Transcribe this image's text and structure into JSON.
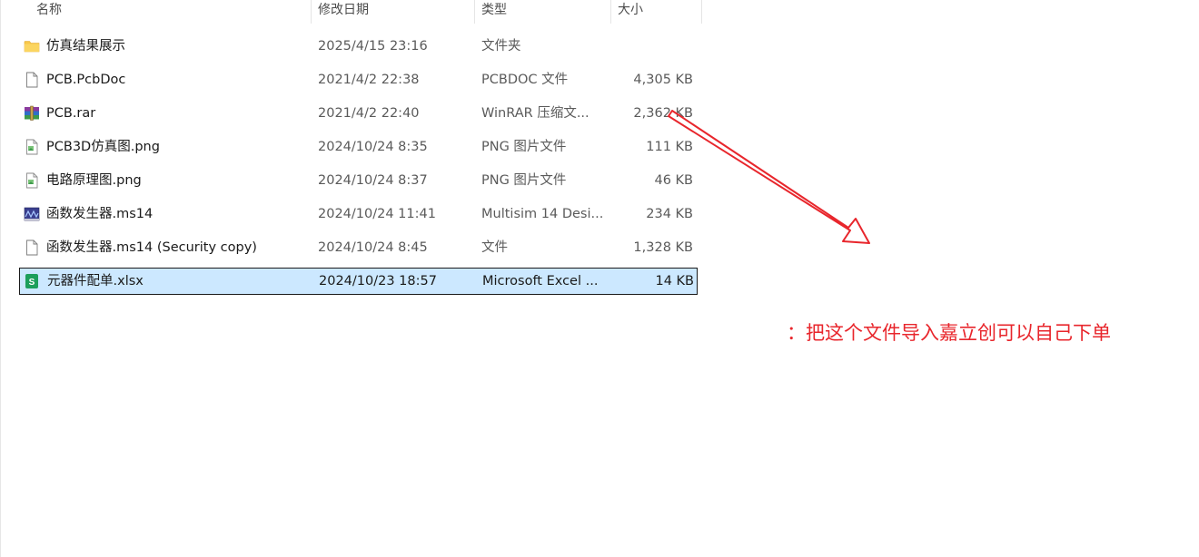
{
  "columns": {
    "name": "名称",
    "date": "修改日期",
    "type": "类型",
    "size": "大小"
  },
  "files": [
    {
      "name": "仿真结果展示",
      "date": "2025/4/15 23:16",
      "type": "文件夹",
      "size": "",
      "icon": "folder-icon"
    },
    {
      "name": "PCB.PcbDoc",
      "date": "2021/4/2 22:38",
      "type": "PCBDOC 文件",
      "size": "4,305 KB",
      "icon": "document-icon"
    },
    {
      "name": "PCB.rar",
      "date": "2021/4/2 22:40",
      "type": "WinRAR 压缩文...",
      "size": "2,362 KB",
      "icon": "winrar-icon"
    },
    {
      "name": "PCB3D仿真图.png",
      "date": "2024/10/24 8:35",
      "type": "PNG 图片文件",
      "size": "111 KB",
      "icon": "image-icon"
    },
    {
      "name": "电路原理图.png",
      "date": "2024/10/24 8:37",
      "type": "PNG 图片文件",
      "size": "46 KB",
      "icon": "image-icon"
    },
    {
      "name": "函数发生器.ms14",
      "date": "2024/10/24 11:41",
      "type": "Multisim 14 Desi...",
      "size": "234 KB",
      "icon": "multisim-icon"
    },
    {
      "name": "函数发生器.ms14 (Security copy)",
      "date": "2024/10/24 8:45",
      "type": "文件",
      "size": "1,328 KB",
      "icon": "document-icon"
    },
    {
      "name": "元器件配单.xlsx",
      "date": "2024/10/23 18:57",
      "type": "Microsoft Excel ...",
      "size": "14 KB",
      "icon": "spreadsheet-icon",
      "selected": true
    }
  ],
  "annotation": {
    "text": "：把这个文件导入嘉立创可以自己下单",
    "color": "#e8262c"
  },
  "colors": {
    "selection": "#cce8ff",
    "folder": "#f8c74a",
    "spreadsheet": "#1d9f5c"
  }
}
